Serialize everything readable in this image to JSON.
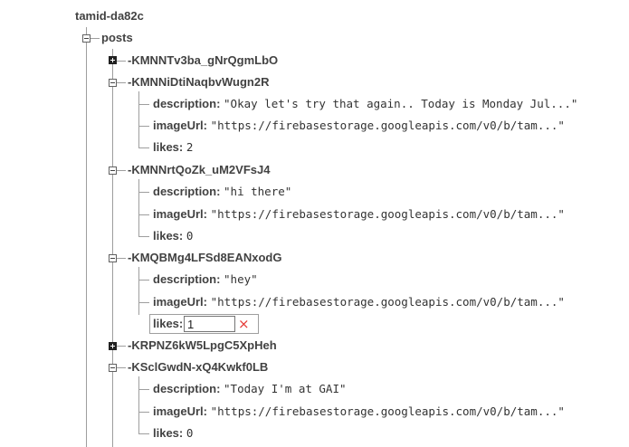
{
  "root": {
    "key": "tamid-da82c"
  },
  "posts_node": {
    "key": "posts"
  },
  "posts": [
    {
      "key": "-KMNNTv3ba_gNrQgmLbO",
      "collapsed": true
    },
    {
      "key": "-KMNNiDtiNaqbvWugn2R",
      "collapsed": false,
      "description": "\"Okay let's try that again.. Today is Monday Jul...\"",
      "imageUrl": "\"https://firebasestorage.googleapis.com/v0/b/tam...\"",
      "likes": "2"
    },
    {
      "key": "-KMNNrtQoZk_uM2VFsJ4",
      "collapsed": false,
      "description": "\"hi there\"",
      "imageUrl": "\"https://firebasestorage.googleapis.com/v0/b/tam...\"",
      "likes": "0"
    },
    {
      "key": "-KMQBMg4LFSd8EANxodG",
      "collapsed": false,
      "description": "\"hey\"",
      "imageUrl": "\"https://firebasestorage.googleapis.com/v0/b/tam...\"",
      "likes_input_value": "1"
    },
    {
      "key": "-KRPNZ6kW5LpgC5XpHeh",
      "collapsed": true
    },
    {
      "key": "-KSclGwdN-xQ4Kwkf0LB",
      "collapsed": false,
      "description": "\"Today I'm at GAI\"",
      "imageUrl": "\"https://firebasestorage.googleapis.com/v0/b/tam...\"",
      "likes": "0"
    }
  ],
  "labels": {
    "description": "description:",
    "imageUrl": "imageUrl:",
    "likes": "likes:"
  },
  "icons": {
    "cancel": "×"
  },
  "colors": {
    "cancel": "#e53935",
    "tree_line": "#9e9e9e"
  }
}
